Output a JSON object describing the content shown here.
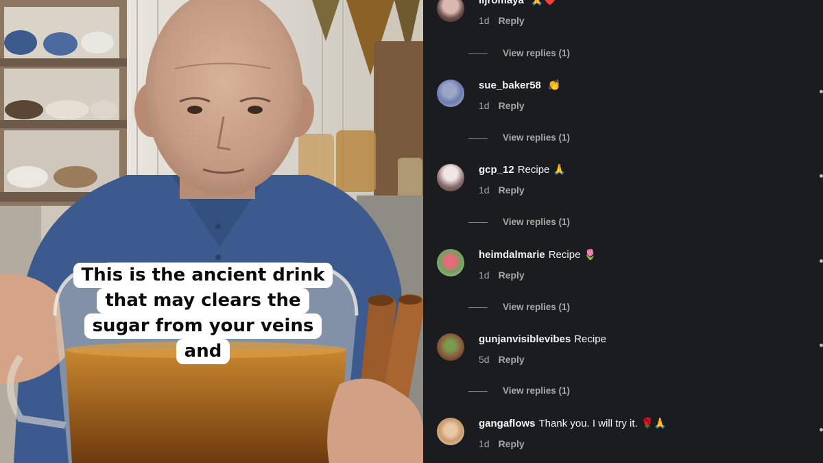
{
  "caption": {
    "lines": [
      "This is the ancient drink",
      "that may clears the",
      "sugar from your veins",
      "and"
    ]
  },
  "comments": [
    {
      "user": "iljromaya",
      "text": "",
      "emoji": "🙏❤️",
      "age": "1d",
      "reply": "Reply",
      "view_replies": "View replies (1)"
    },
    {
      "user": "sue_baker58",
      "text": "",
      "emoji": "👏",
      "age": "1d",
      "reply": "Reply",
      "view_replies": "View replies (1)"
    },
    {
      "user": "gcp_12",
      "text": "Recipe",
      "emoji": "🙏",
      "age": "1d",
      "reply": "Reply",
      "view_replies": "View replies (1)"
    },
    {
      "user": "heimdalmarie",
      "text": "Recipe",
      "emoji": "🌷",
      "age": "1d",
      "reply": "Reply",
      "view_replies": "View replies (1)"
    },
    {
      "user": "gunjanvisiblevibes",
      "text": "Recipe",
      "emoji": "",
      "age": "5d",
      "reply": "Reply",
      "view_replies": "View replies (1)"
    },
    {
      "user": "gangaflows",
      "text": "Thank you. I will try it.",
      "emoji": "🌹🙏",
      "age": "1d",
      "reply": "Reply",
      "view_replies": ""
    }
  ],
  "colors": {
    "comments_bg": "#1b1c1f",
    "comment_text": "#f3f3f3",
    "meta_text": "#a8a8a8",
    "caption_bg": "#ffffff",
    "shirt_blue": "#3c5a8e",
    "tea_amber": "#a9641f"
  }
}
